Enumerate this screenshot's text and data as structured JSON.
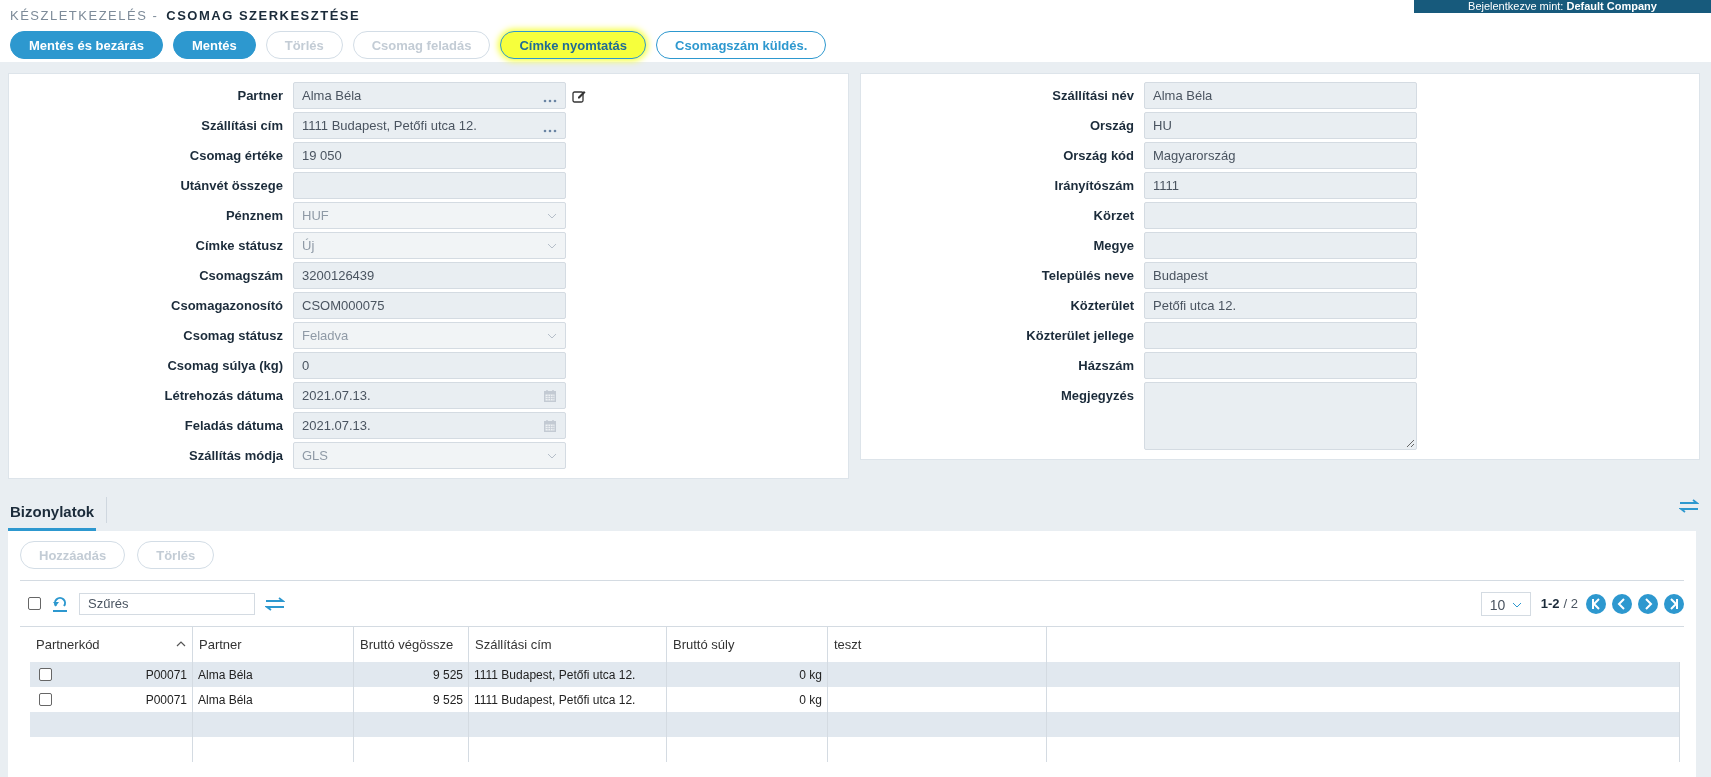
{
  "header": {
    "breadcrumb": "KÉSZLETKEZELÉS -",
    "title": "CSOMAG SZERKESZTÉSE",
    "user_banner": "Bejelentkezve mint: **Default Company**"
  },
  "toolbar": [
    {
      "label": "Mentés és bezárás",
      "kind": "primary",
      "disabled": false,
      "highlighted": false
    },
    {
      "label": "Mentés",
      "kind": "primary",
      "disabled": false,
      "highlighted": false
    },
    {
      "label": "Törlés",
      "kind": "outline",
      "disabled": true,
      "highlighted": false
    },
    {
      "label": "Csomag feladás",
      "kind": "outline",
      "disabled": true,
      "highlighted": false
    },
    {
      "label": "Címke nyomtatás",
      "kind": "outline",
      "disabled": false,
      "highlighted": true
    },
    {
      "label": "Csomagszám küldés.",
      "kind": "outline",
      "disabled": false,
      "highlighted": false
    }
  ],
  "left_form": [
    {
      "label": "Partner",
      "kind": "lookup",
      "value": "Alma Béla",
      "has_edit": true
    },
    {
      "label": "Szállítási cím",
      "kind": "lookup",
      "value": "1111 Budapest, Petőfi utca 12.",
      "has_edit": false
    },
    {
      "label": "Csomag értéke",
      "kind": "text",
      "value": "19 050"
    },
    {
      "label": "Utánvét összege",
      "kind": "text"
    },
    {
      "label": "Pénznem",
      "kind": "select",
      "value": "HUF"
    },
    {
      "label": "Címke státusz",
      "kind": "select",
      "value": "Új"
    },
    {
      "label": "Csomagszám",
      "kind": "text",
      "value": "3200126439"
    },
    {
      "label": "Csomagazonosító",
      "kind": "text",
      "value": "CSOM000075"
    },
    {
      "label": "Csomag státusz",
      "kind": "select",
      "value": "Feladva"
    },
    {
      "label": "Csomag súlya (kg)",
      "kind": "text",
      "value": "0"
    },
    {
      "label": "Létrehozás dátuma",
      "kind": "date",
      "value": "2021.07.13."
    },
    {
      "label": "Feladás dátuma",
      "kind": "date",
      "value": "2021.07.13."
    },
    {
      "label": "Szállítás módja",
      "kind": "select",
      "value": "GLS"
    }
  ],
  "right_form": [
    {
      "label": "Szállítási név",
      "kind": "text",
      "value": "Alma Béla"
    },
    {
      "label": "Ország",
      "kind": "text",
      "value": "HU"
    },
    {
      "label": "Ország kód",
      "kind": "text",
      "value": "Magyarország"
    },
    {
      "label": "Irányítószám",
      "kind": "text",
      "value": "1111"
    },
    {
      "label": "Körzet",
      "kind": "text"
    },
    {
      "label": "Megye",
      "kind": "text"
    },
    {
      "label": "Település neve",
      "kind": "text",
      "value": "Budapest"
    },
    {
      "label": "Közterület",
      "kind": "text",
      "value": "Petőfi utca 12."
    },
    {
      "label": "Közterület jellege",
      "kind": "text"
    },
    {
      "label": "Házszám",
      "kind": "text"
    },
    {
      "label": "Megjegyzés",
      "kind": "textarea"
    }
  ],
  "tabs": [
    {
      "label": "Bizonylatok",
      "selected": true
    }
  ],
  "grid_actions": [
    {
      "label": "Hozzáadás",
      "disabled": true
    },
    {
      "label": "Törlés",
      "disabled": true
    }
  ],
  "grid": {
    "select_all_checked": false,
    "filter_placeholder": "Szűrés",
    "page_size": "10",
    "range": "1-2",
    "total": "/ 2",
    "columns": [
      {
        "label": "Partnerkód",
        "sorted": true
      },
      {
        "label": "Partner",
        "sorted": false
      },
      {
        "label": "Bruttó végössze",
        "sorted": false
      },
      {
        "label": "Szállítási cím",
        "sorted": false
      },
      {
        "label": "Bruttó súly",
        "sorted": false
      },
      {
        "label": "teszt",
        "sorted": false
      }
    ],
    "rows": [
      {
        "checked": false,
        "cells": [
          "P00071",
          "Alma Béla",
          "9 525",
          "1111 Budapest, Petőfi utca 12.",
          "0 kg",
          ""
        ]
      },
      {
        "checked": false,
        "cells": [
          "P00071",
          "Alma Béla",
          "9 525",
          "1111 Budapest, Petőfi utca 12.",
          "0 kg",
          ""
        ]
      }
    ]
  }
}
